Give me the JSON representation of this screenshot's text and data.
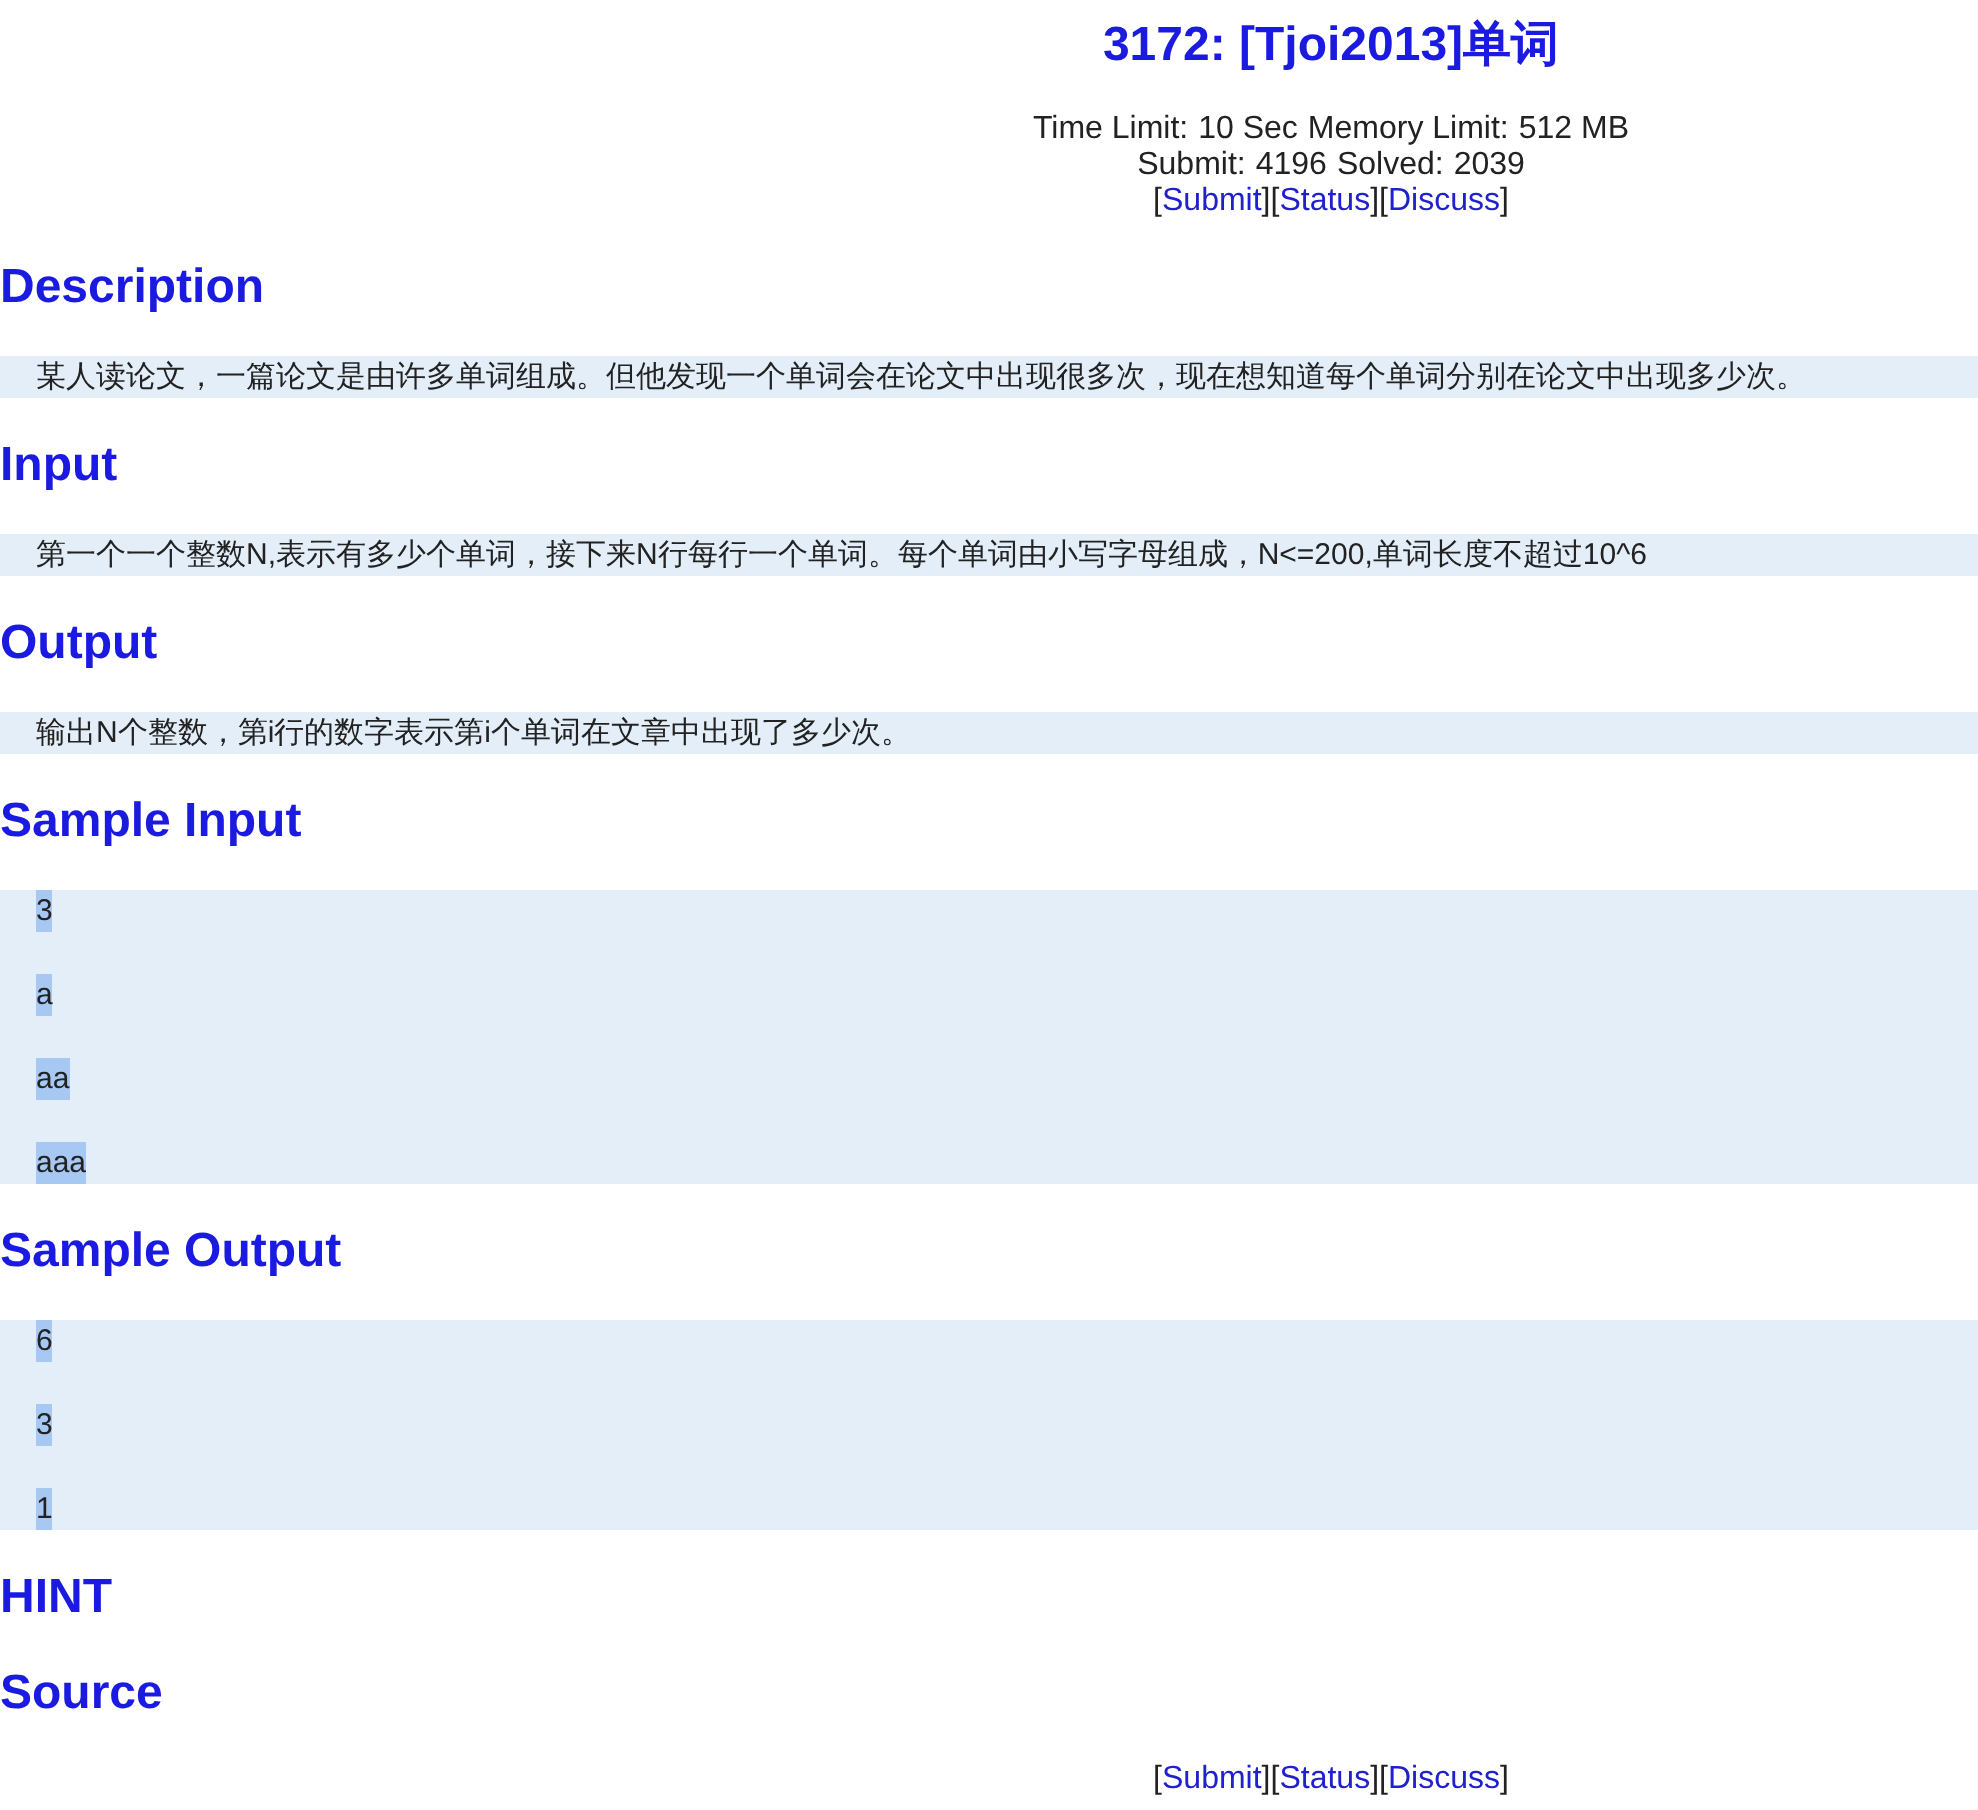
{
  "header": {
    "title": "3172: [Tjoi2013]单词",
    "limits": [
      {
        "label": "Time Limit:",
        "value": "10 Sec"
      },
      {
        "label": "Memory Limit:",
        "value": "512 MB"
      }
    ],
    "stats": [
      {
        "label": "Submit:",
        "value": "4196"
      },
      {
        "label": "Solved:",
        "value": "2039"
      }
    ],
    "links": [
      {
        "before": "[",
        "label": "Submit",
        "after": "]"
      },
      {
        "before": "[",
        "label": "Status",
        "after": "]"
      },
      {
        "before": "[",
        "label": "Discuss",
        "after": "]"
      }
    ]
  },
  "sections": [
    {
      "heading": "Description",
      "kind": "text",
      "lines": [
        {
          "text": "某人读论文，一篇论文是由许多单词组成。但他发现一个单词会在论文中出现很多次，现在想知道每个单词分别在论文中出现多少次。",
          "selected": false
        }
      ]
    },
    {
      "heading": "Input",
      "kind": "text",
      "lines": [
        {
          "text": "第一个一个整数N,表示有多少个单词，接下来N行每行一个单词。每个单词由小写字母组成，N<=200,单词长度不超过10^6",
          "selected": false
        }
      ]
    },
    {
      "heading": "Output",
      "kind": "text",
      "lines": [
        {
          "text": "输出N个整数，第i行的数字表示第i个单词在文章中出现了多少次。",
          "selected": false
        }
      ]
    },
    {
      "heading": "Sample Input",
      "kind": "sample",
      "lines": [
        {
          "text": "3",
          "selected": true
        },
        {
          "text": "a",
          "selected": true
        },
        {
          "text": "aa",
          "selected": true
        },
        {
          "text": "aaa",
          "selected": true
        }
      ]
    },
    {
      "heading": "Sample Output",
      "kind": "sample",
      "lines": [
        {
          "text": "6",
          "selected": true
        },
        {
          "text": "3",
          "selected": true
        },
        {
          "text": "1",
          "selected": true
        }
      ]
    },
    {
      "heading": "HINT",
      "kind": "empty"
    },
    {
      "heading": "Source",
      "kind": "empty"
    }
  ],
  "footer": {
    "links": [
      {
        "before": "[",
        "label": "Submit",
        "after": "]"
      },
      {
        "before": "[",
        "label": "Status",
        "after": "]"
      },
      {
        "before": "[",
        "label": "Discuss",
        "after": "]"
      }
    ]
  }
}
